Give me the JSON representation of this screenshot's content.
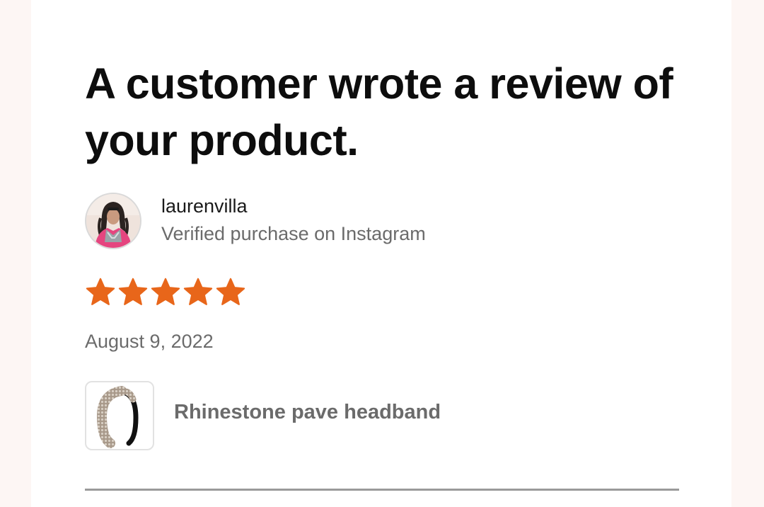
{
  "notification": {
    "headline": "A customer wrote a review of your product."
  },
  "reviewer": {
    "username": "laurenvilla",
    "source": "Verified purchase on Instagram",
    "avatar_icon": "avatar-photo"
  },
  "rating": {
    "stars": 5,
    "max": 5,
    "color": "#e8661a",
    "icon": "star-icon"
  },
  "review": {
    "date": "August 9, 2022"
  },
  "product": {
    "name": "Rhinestone pave headband",
    "thumbnail_icon": "headband-thumbnail"
  },
  "colors": {
    "star": "#e8661a",
    "headline": "#0d0d0d",
    "muted_text": "#6b6b6b",
    "background": "#fdf6f4"
  }
}
